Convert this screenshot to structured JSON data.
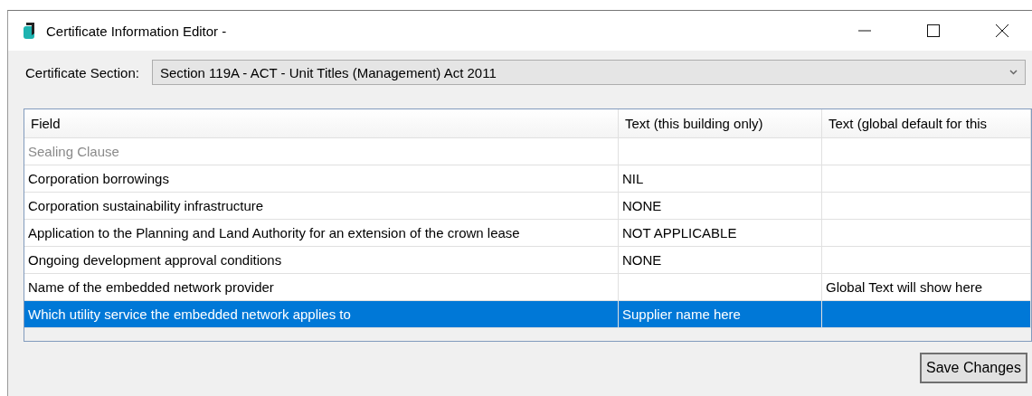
{
  "window": {
    "title": "Certificate Information Editor -"
  },
  "section_picker": {
    "label": "Certificate Section:",
    "value": "Section 119A - ACT - Unit Titles (Management) Act 2011"
  },
  "table": {
    "columns": [
      "Field",
      "Text (this building only)",
      "Text (global default for this"
    ],
    "rows": [
      {
        "field": "Sealing Clause",
        "text": "",
        "global": "",
        "disabled": true,
        "selected": false
      },
      {
        "field": "Corporation borrowings",
        "text": "NIL",
        "global": "",
        "disabled": false,
        "selected": false
      },
      {
        "field": "Corporation sustainability infrastructure",
        "text": "NONE",
        "global": "",
        "disabled": false,
        "selected": false
      },
      {
        "field": "Application to the Planning and Land Authority for an extension of the crown lease",
        "text": "NOT APPLICABLE",
        "global": "",
        "disabled": false,
        "selected": false
      },
      {
        "field": "Ongoing development approval conditions",
        "text": "NONE",
        "global": "",
        "disabled": false,
        "selected": false
      },
      {
        "field": "Name of the embedded network provider",
        "text": "",
        "global": "Global Text will show here",
        "disabled": false,
        "selected": false
      },
      {
        "field": "Which utility service the embedded network applies to",
        "text": "Supplier name here",
        "global": "",
        "disabled": false,
        "selected": true
      }
    ]
  },
  "buttons": [
    "Save Changes"
  ]
}
